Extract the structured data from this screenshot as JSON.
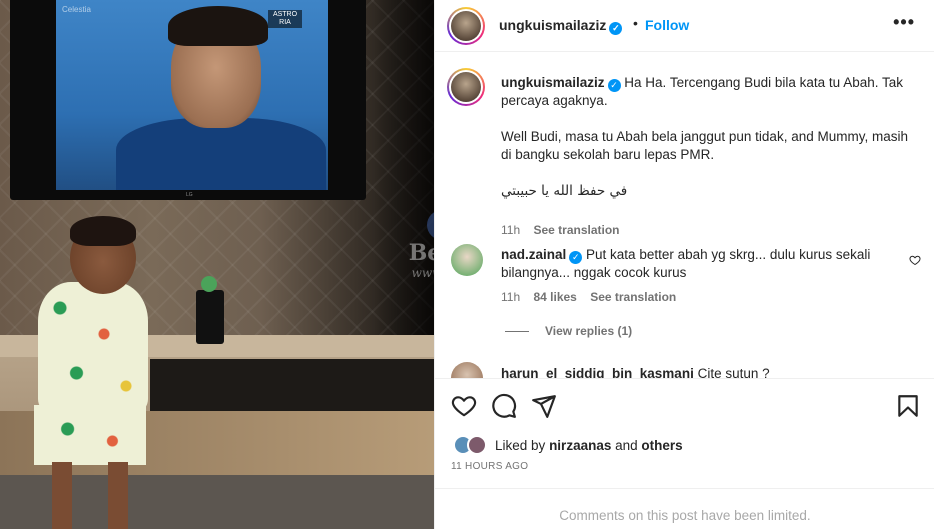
{
  "post": {
    "username": "ungkuismailaziz",
    "follow_label": "Follow",
    "dot": "•",
    "more_label": "•••"
  },
  "photo": {
    "tv_watermark": "Celestia",
    "tv_badge": "ASTRO RIA",
    "tv_brand": "LG"
  },
  "watermark": {
    "brand": "Beritakopi",
    "url": "www.beritakopi.com"
  },
  "caption": {
    "username": "ungkuismailaziz",
    "line1": "Ha Ha. Tercengang Budi bila kata tu Abah. Tak percaya agaknya.",
    "line2": "Well Budi, masa tu Abah bela janggut pun tidak, and Mummy, masih di bangku sekolah baru lepas PMR.",
    "line3": "في حفظ الله يا حبيبتي",
    "time": "11h",
    "see_translation": "See translation"
  },
  "comment": {
    "username": "nad.zainal",
    "text": "Put kata better abah yg skrg... dulu kurus sekali bilangnya... nggak cocok kurus",
    "time": "11h",
    "likes": "84 likes",
    "see_translation": "See translation",
    "view_replies": "View replies (1)"
  },
  "comment_partial": {
    "username": "harun_el_siddiq_bin_kasmani",
    "text": "Cite sutun ?"
  },
  "actions": {
    "liked_prefix": "Liked by",
    "liked_user": "nirzaanas",
    "liked_and": "and",
    "liked_others": "others",
    "time": "11 HOURS AGO"
  },
  "footer": {
    "limited": "Comments on this post have been limited."
  },
  "colors": {
    "accent": "#0095f6",
    "text": "#262626",
    "muted": "#737373"
  }
}
